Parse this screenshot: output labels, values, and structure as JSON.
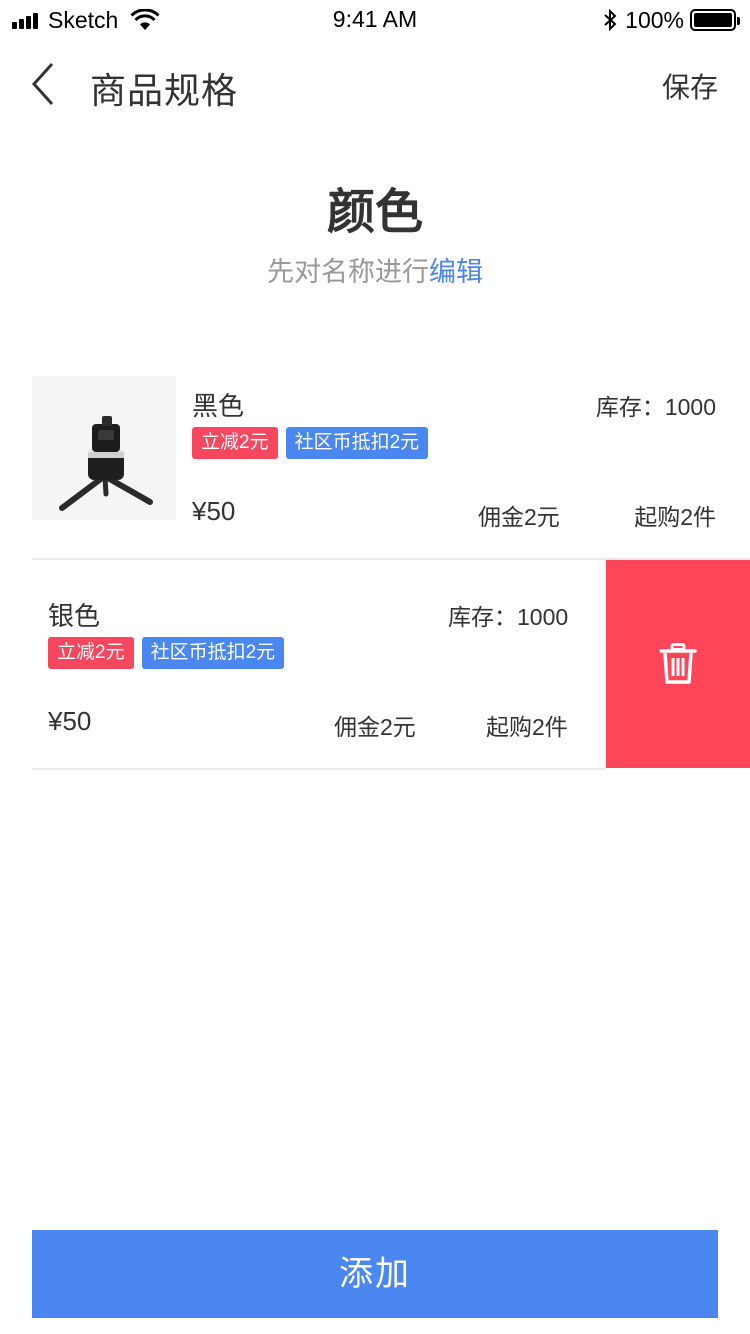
{
  "status_bar": {
    "carrier": "Sketch",
    "time": "9:41 AM",
    "battery": "100%"
  },
  "nav": {
    "title": "商品规格",
    "save_label": "保存",
    "back_icon": "chevron-left-icon"
  },
  "header": {
    "title": "颜色",
    "hint_prefix": "先对名称进行",
    "hint_link": "编辑"
  },
  "specs": [
    {
      "name": "黑色",
      "stock": "库存：1000",
      "tags": [
        "立减2元",
        "社区币抵扣2元"
      ],
      "price": "¥50",
      "commission": "佣金2元",
      "min_purchase": "起购2件"
    },
    {
      "name": "银色",
      "stock": "库存：1000",
      "tags": [
        "立减2元",
        "社区币抵扣2元"
      ],
      "price": "¥50",
      "commission": "佣金2元",
      "min_purchase": "起购2件"
    }
  ],
  "delete_icon": "trash-icon",
  "add_label": "添加",
  "colors": {
    "accent_blue": "#4a87f0",
    "tag_red": "#f7475e",
    "delete_red": "#ff4659",
    "hint_gray": "#999999"
  }
}
